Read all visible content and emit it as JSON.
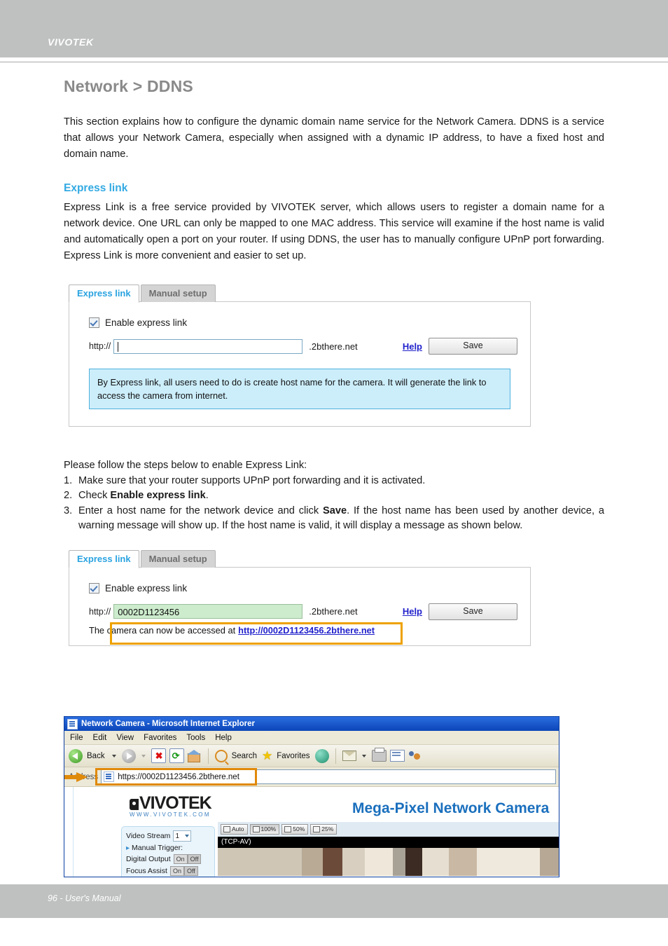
{
  "header": {
    "brand": "VIVOTEK"
  },
  "page": {
    "title": "Network > DDNS",
    "intro": "This section explains how to configure the dynamic domain name service for the Network Camera. DDNS is a service that allows your Network Camera, especially when assigned with a dynamic IP address, to have a fixed host and domain name.",
    "section_heading": "Express link",
    "section_body": "Express Link is a free service provided by VIVOTEK server, which allows users to register a domain name for a network device. One URL can only be mapped to one MAC address. This service will examine if the host name is valid and automatically open a port on your router. If using DDNS, the user has to manually configure UPnP port forwarding. Express Link is more convenient and easier to set up."
  },
  "steps": {
    "intro": "Please follow the steps below to enable Express Link:",
    "items": [
      {
        "num": "1.",
        "pre": "Make sure that your router supports UPnP port forwarding and it is activated.",
        "bold": "",
        "post": ""
      },
      {
        "num": "2.",
        "pre": "Check ",
        "bold": "Enable express link",
        "post": "."
      },
      {
        "num": "3.",
        "pre": "Enter a host name for the network device and click ",
        "bold": "Save",
        "post": ". If the host name has been used by another device, a warning message will show up. If the host name is valid, it will display a message as shown below."
      }
    ]
  },
  "widget_empty": {
    "tab_active": "Express link",
    "tab_inactive": "Manual setup",
    "checkbox_label": "Enable express link",
    "protocol": "http://",
    "host_value": "",
    "domain_suffix": ".2bthere.net",
    "help_label": "Help",
    "save_label": "Save",
    "info_text": "By Express link, all users need to do is create host name for the camera. It will generate the link to access the camera from internet."
  },
  "widget_filled": {
    "tab_active": "Express link",
    "tab_inactive": "Manual setup",
    "checkbox_label": "Enable express link",
    "protocol": "http://",
    "host_value": "0002D1123456",
    "domain_suffix": ".2bthere.net",
    "help_label": "Help",
    "save_label": "Save",
    "result_prefix": "The camera can now be accessed at",
    "result_link": "http://0002D1123456.2bthere.net"
  },
  "browser": {
    "title": "Network Camera - Microsoft Internet Explorer",
    "menus": [
      "File",
      "Edit",
      "View",
      "Favorites",
      "Tools",
      "Help"
    ],
    "toolbar": {
      "back_label": "Back",
      "search_label": "Search",
      "favorites_label": "Favorites"
    },
    "address_label": "Address",
    "address_value": "https://0002D1123456.2bthere.net",
    "camera_page": {
      "logo_text": "VIVOTEK",
      "logo_sub": "WWW.VIVOTEK.COM",
      "heading": "Mega-Pixel Network Camera",
      "controls": [
        {
          "label": "Video Stream",
          "type": "select",
          "value": "1"
        },
        {
          "label": "Manual Trigger:",
          "type": "link",
          "value": ""
        },
        {
          "label": "Digital Output",
          "type": "onoff",
          "on": "On",
          "off": "Off",
          "selected": "Off"
        },
        {
          "label": "Focus Assist",
          "type": "onoff",
          "on": "On",
          "off": "Off",
          "selected": "Off"
        }
      ],
      "zoom_buttons": [
        "Auto",
        "100%",
        "50%",
        "25%"
      ],
      "zoom_selected": "100%",
      "stream_status": "(TCP-AV)"
    }
  },
  "footer": {
    "text": "96 - User's Manual"
  },
  "colors": {
    "header_band": "#bfc0c0",
    "title_gray": "#8a8a8a",
    "accent_blue": "#33aae3",
    "info_bg": "#cceefb",
    "highlight_orange": "#e08a0a",
    "filled_field": "#cdeccd"
  }
}
